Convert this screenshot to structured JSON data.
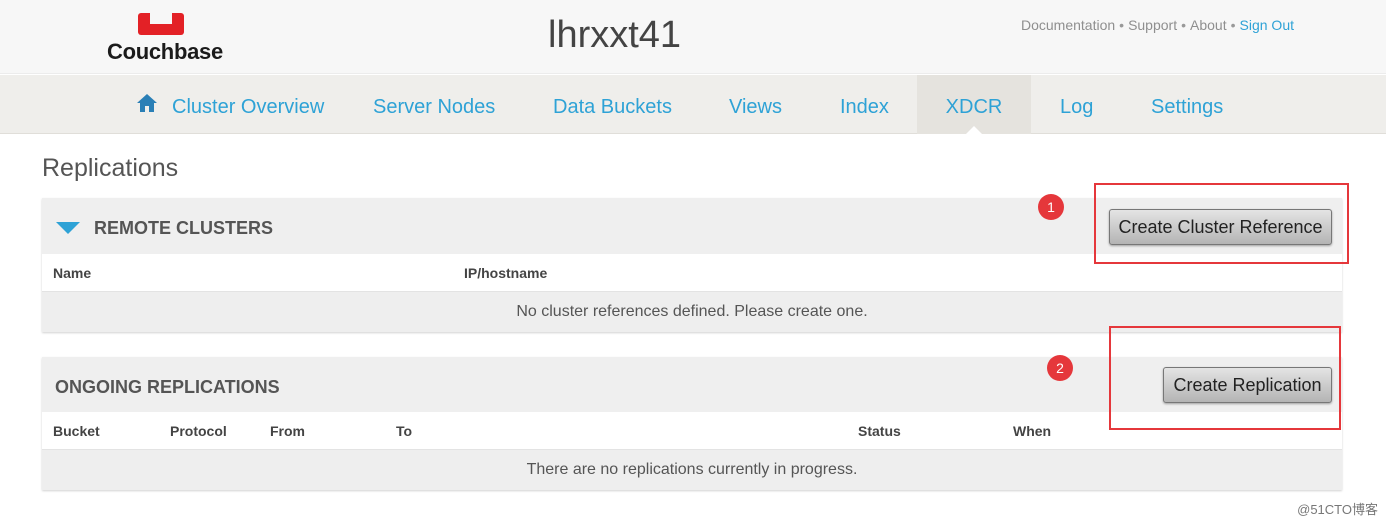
{
  "header": {
    "logo_text": "Couchbase",
    "cluster_name": "lhrxxt41",
    "links": {
      "documentation": "Documentation",
      "support": "Support",
      "about": "About",
      "sign_out": "Sign Out",
      "separator": "•"
    }
  },
  "nav": {
    "items": [
      {
        "label": "Cluster Overview",
        "icon": "home-icon"
      },
      {
        "label": "Server Nodes"
      },
      {
        "label": "Data Buckets"
      },
      {
        "label": "Views"
      },
      {
        "label": "Index"
      },
      {
        "label": "XDCR",
        "active": true
      },
      {
        "label": "Log"
      },
      {
        "label": "Settings"
      }
    ]
  },
  "page": {
    "title": "Replications"
  },
  "remote_clusters": {
    "title": "REMOTE CLUSTERS",
    "button": "Create Cluster Reference",
    "columns": [
      "Name",
      "IP/hostname"
    ],
    "empty": "No cluster references defined. Please create one.",
    "marker": "1"
  },
  "ongoing": {
    "title": "ONGOING REPLICATIONS",
    "button": "Create Replication",
    "columns": [
      "Bucket",
      "Protocol",
      "From",
      "To",
      "Status",
      "When"
    ],
    "empty": "There are no replications currently in progress.",
    "marker": "2"
  },
  "watermark": "@51CTO博客",
  "colors": {
    "accent": "#2ea2d6",
    "brand_red": "#e32126",
    "annotation_red": "#e5373b"
  }
}
